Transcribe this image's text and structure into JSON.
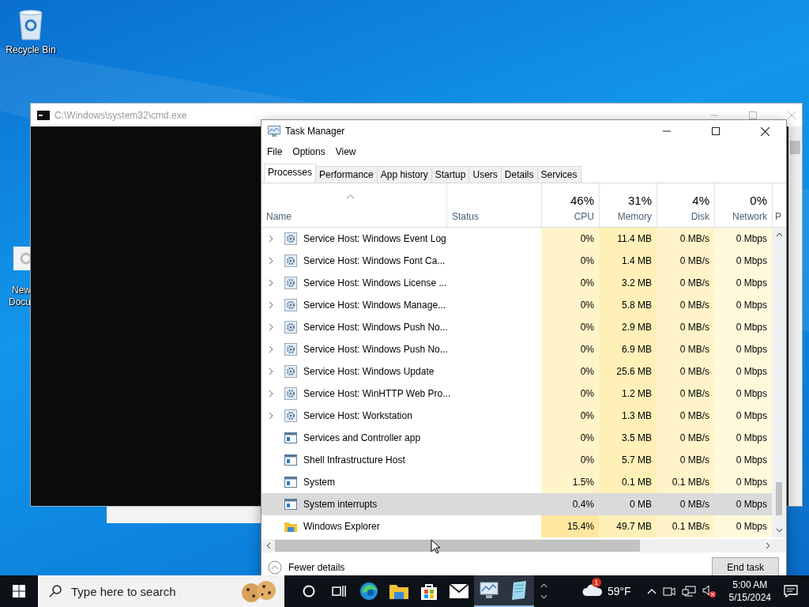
{
  "desktop_icons": [
    {
      "label": "Recycle Bin",
      "kind": "recycle"
    },
    {
      "label": "New Docu",
      "kind": "document"
    }
  ],
  "cmd_window": {
    "title": "C:\\Windows\\system32\\cmd.exe"
  },
  "task_manager": {
    "title": "Task Manager",
    "menu": [
      "File",
      "Options",
      "View"
    ],
    "tabs": [
      {
        "label": "Processes",
        "selected": true
      },
      {
        "label": "Performance",
        "selected": false
      },
      {
        "label": "App history",
        "selected": false
      },
      {
        "label": "Startup",
        "selected": false
      },
      {
        "label": "Users",
        "selected": false
      },
      {
        "label": "Details",
        "selected": false
      },
      {
        "label": "Services",
        "selected": false
      }
    ],
    "columns": [
      {
        "label": "Name"
      },
      {
        "label": "Status"
      },
      {
        "label": "CPU",
        "total": "46%"
      },
      {
        "label": "Memory",
        "total": "31%"
      },
      {
        "label": "Disk",
        "total": "4%"
      },
      {
        "label": "Network",
        "total": "0%"
      },
      {
        "label": "P"
      }
    ],
    "rows": [
      {
        "name": "Service Host: Windows Event Log",
        "expandable": true,
        "kind": "gear",
        "cpu": "0%",
        "memory": "11.4 MB",
        "disk": "0 MB/s",
        "network": "0 Mbps",
        "selected": false
      },
      {
        "name": "Service Host: Windows Font Ca...",
        "expandable": true,
        "kind": "gear",
        "cpu": "0%",
        "memory": "1.4 MB",
        "disk": "0 MB/s",
        "network": "0 Mbps",
        "selected": false
      },
      {
        "name": "Service Host: Windows License ...",
        "expandable": true,
        "kind": "gear",
        "cpu": "0%",
        "memory": "3.2 MB",
        "disk": "0 MB/s",
        "network": "0 Mbps",
        "selected": false
      },
      {
        "name": "Service Host: Windows Manage...",
        "expandable": true,
        "kind": "gear",
        "cpu": "0%",
        "memory": "5.8 MB",
        "disk": "0 MB/s",
        "network": "0 Mbps",
        "selected": false
      },
      {
        "name": "Service Host: Windows Push No...",
        "expandable": true,
        "kind": "gear",
        "cpu": "0%",
        "memory": "2.9 MB",
        "disk": "0 MB/s",
        "network": "0 Mbps",
        "selected": false
      },
      {
        "name": "Service Host: Windows Push No...",
        "expandable": true,
        "kind": "gear",
        "cpu": "0%",
        "memory": "6.9 MB",
        "disk": "0 MB/s",
        "network": "0 Mbps",
        "selected": false
      },
      {
        "name": "Service Host: Windows Update",
        "expandable": true,
        "kind": "gear",
        "cpu": "0%",
        "memory": "25.6 MB",
        "disk": "0 MB/s",
        "network": "0 Mbps",
        "selected": false
      },
      {
        "name": "Service Host: WinHTTP Web Pro...",
        "expandable": true,
        "kind": "gear",
        "cpu": "0%",
        "memory": "1.2 MB",
        "disk": "0 MB/s",
        "network": "0 Mbps",
        "selected": false
      },
      {
        "name": "Service Host: Workstation",
        "expandable": true,
        "kind": "gear",
        "cpu": "0%",
        "memory": "1.3 MB",
        "disk": "0 MB/s",
        "network": "0 Mbps",
        "selected": false
      },
      {
        "name": "Services and Controller app",
        "expandable": false,
        "kind": "app",
        "cpu": "0%",
        "memory": "3.5 MB",
        "disk": "0 MB/s",
        "network": "0 Mbps",
        "selected": false
      },
      {
        "name": "Shell Infrastructure Host",
        "expandable": false,
        "kind": "app",
        "cpu": "0%",
        "memory": "5.7 MB",
        "disk": "0 MB/s",
        "network": "0 Mbps",
        "selected": false
      },
      {
        "name": "System",
        "expandable": false,
        "kind": "app",
        "cpu": "1.5%",
        "memory": "0.1 MB",
        "disk": "0.1 MB/s",
        "network": "0 Mbps",
        "selected": false
      },
      {
        "name": "System interrupts",
        "expandable": false,
        "kind": "app",
        "cpu": "0.4%",
        "memory": "0 MB",
        "disk": "0 MB/s",
        "network": "0 Mbps",
        "selected": true
      },
      {
        "name": "Windows Explorer",
        "expandable": false,
        "kind": "folder",
        "cpu": "15.4%",
        "memory": "49.7 MB",
        "disk": "0.1 MB/s",
        "network": "0 Mbps",
        "selected": false
      }
    ],
    "fewer_details": "Fewer details",
    "end_task": "End task"
  },
  "taskbar": {
    "search": {
      "placeholder": "Type here to search"
    },
    "apps": [
      {
        "kind": "cortana",
        "active": false
      },
      {
        "kind": "taskview",
        "active": false
      },
      {
        "kind": "edge",
        "active": false
      },
      {
        "kind": "folder",
        "active": false
      },
      {
        "kind": "store",
        "active": false
      },
      {
        "kind": "mail",
        "active": false
      },
      {
        "kind": "taskmgr",
        "active": true
      },
      {
        "kind": "notepad",
        "active": true
      }
    ],
    "weather": {
      "temperature": "59°F",
      "badge": "1"
    },
    "time": "5:00 AM",
    "date": "5/15/2024"
  }
}
